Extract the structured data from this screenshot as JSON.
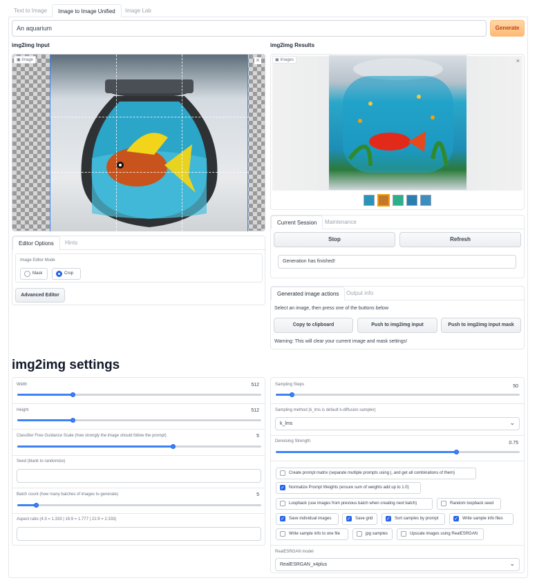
{
  "tabs": [
    {
      "label": "Text to Image"
    },
    {
      "label": "Image to Image Unified"
    },
    {
      "label": "Image Lab"
    }
  ],
  "prompt": {
    "value": "An aquarium"
  },
  "generate_label": "Generate",
  "input_panel": {
    "title": "img2img Input",
    "chip": "Image",
    "editor_tabs": [
      {
        "label": "Editor Options"
      },
      {
        "label": "Hints"
      }
    ],
    "mode_label": "Image Editor Mode",
    "mode_options": [
      {
        "label": "Mask",
        "selected": false
      },
      {
        "label": "Crop",
        "selected": true
      }
    ],
    "advanced_label": "Advanced Editor"
  },
  "results_panel": {
    "title": "img2img Results",
    "chip": "Images"
  },
  "session": {
    "tabs": [
      {
        "label": "Current Session"
      },
      {
        "label": "Maintenance"
      }
    ],
    "stop_label": "Stop",
    "refresh_label": "Refresh",
    "status": "Generation has finished!"
  },
  "actions": {
    "tabs": [
      {
        "label": "Generated image actions"
      },
      {
        "label": "Output info"
      }
    ],
    "hint": "Select an image, then press one of the buttons below",
    "copy_label": "Copy to clipboard",
    "push_label": "Push to img2img input",
    "push_mask_label": "Push to img2img input mask",
    "warning": "Warning: This will clear your current image and mask settings!"
  },
  "settings_title": "img2img settings",
  "left_settings": {
    "width": {
      "label": "Width",
      "value": "512",
      "fraction": 0.23
    },
    "height": {
      "label": "Height",
      "value": "512",
      "fraction": 0.23
    },
    "cfg": {
      "label": "Classifier Free Guidance Scale (how strongly the image should follow the prompt)",
      "value": "5",
      "fraction": 0.64
    },
    "seed": {
      "label": "Seed (blank to randomize)",
      "value": ""
    },
    "batch": {
      "label": "Batch count (how many batches of images to generate)",
      "value": "5",
      "fraction": 0.08
    },
    "aspect": {
      "label": "Aspect ratio (4:3 = 1.333 | 16:9 = 1.777 | 21:9 = 2.333)",
      "value": ""
    }
  },
  "right_settings": {
    "steps": {
      "label": "Sampling Steps",
      "value": "50",
      "fraction": 0.07
    },
    "sampler": {
      "label": "Sampling method (k_lms is default k-diffusion sampler)",
      "value": "k_lms"
    },
    "denoise": {
      "label": "Denoising Strength",
      "value": "0.75",
      "fraction": 0.74
    },
    "checkboxes": [
      {
        "label": "Create prompt matrix (separate multiple prompts using |, and get all combinations of them)",
        "checked": false
      },
      {
        "label": "Normalize Prompt Weights (ensure sum of weights add up to 1.0)",
        "checked": true
      },
      {
        "label": "Loopback (use images from previous batch when creating next batch)",
        "checked": false
      },
      {
        "label": "Random loopback seed",
        "checked": false
      },
      {
        "label": "Save individual images",
        "checked": true
      },
      {
        "label": "Save grid",
        "checked": true
      },
      {
        "label": "Sort samples by prompt",
        "checked": true
      },
      {
        "label": "Write sample info files",
        "checked": true
      },
      {
        "label": "Write sample info to one file",
        "checked": false
      },
      {
        "label": "jpg samples",
        "checked": false
      },
      {
        "label": "Upscale images using RealESRGAN",
        "checked": false
      }
    ],
    "realesrgan": {
      "label": "RealESRGAN model",
      "value": "RealESRGAN_x4plus"
    }
  },
  "colors": {
    "accent": "#3b82f6",
    "generate": "#fdba74",
    "generate_text": "#c2410c"
  },
  "icons": {
    "close": "close-icon",
    "image": "image-icon",
    "chevron": "chevron-down-icon"
  }
}
